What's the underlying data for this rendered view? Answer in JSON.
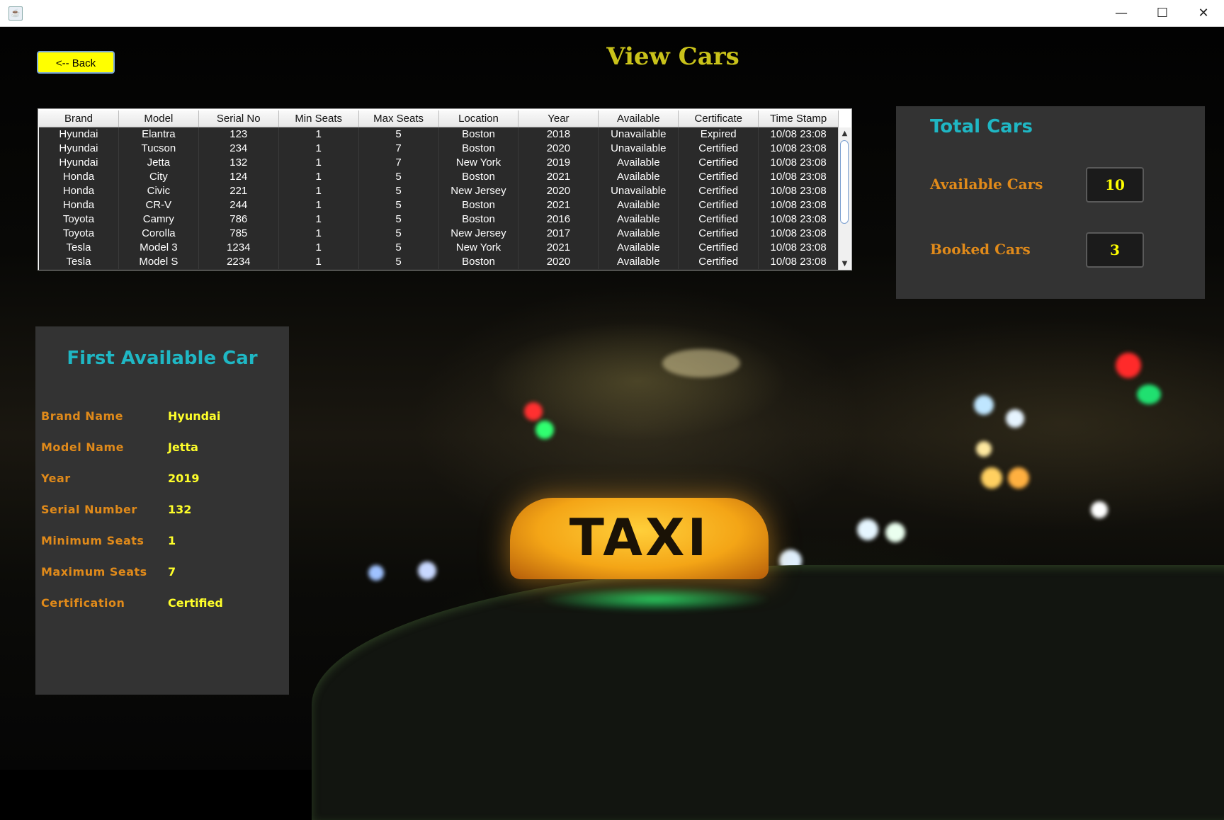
{
  "window": {
    "minimize_glyph": "—",
    "maximize_glyph": "☐",
    "close_glyph": "✕"
  },
  "back_button": "<-- Back",
  "page_title": "View Cars",
  "table": {
    "headers": [
      "Brand",
      "Model",
      "Serial No",
      "Min Seats",
      "Max Seats",
      "Location",
      "Year",
      "Available",
      "Certificate",
      "Time Stamp"
    ],
    "rows": [
      [
        "Hyundai",
        "Elantra",
        "123",
        "1",
        "5",
        "Boston",
        "2018",
        "Unavailable",
        "Expired",
        "10/08 23:08"
      ],
      [
        "Hyundai",
        "Tucson",
        "234",
        "1",
        "7",
        "Boston",
        "2020",
        "Unavailable",
        "Certified",
        "10/08 23:08"
      ],
      [
        "Hyundai",
        "Jetta",
        "132",
        "1",
        "7",
        "New York",
        "2019",
        "Available",
        "Certified",
        "10/08 23:08"
      ],
      [
        "Honda",
        "City",
        "124",
        "1",
        "5",
        "Boston",
        "2021",
        "Available",
        "Certified",
        "10/08 23:08"
      ],
      [
        "Honda",
        "Civic",
        "221",
        "1",
        "5",
        "New Jersey",
        "2020",
        "Unavailable",
        "Certified",
        "10/08 23:08"
      ],
      [
        "Honda",
        "CR-V",
        "244",
        "1",
        "5",
        "Boston",
        "2021",
        "Available",
        "Certified",
        "10/08 23:08"
      ],
      [
        "Toyota",
        "Camry",
        "786",
        "1",
        "5",
        "Boston",
        "2016",
        "Available",
        "Certified",
        "10/08 23:08"
      ],
      [
        "Toyota",
        "Corolla",
        "785",
        "1",
        "5",
        "New Jersey",
        "2017",
        "Available",
        "Certified",
        "10/08 23:08"
      ],
      [
        "Tesla",
        "Model 3",
        "1234",
        "1",
        "5",
        "New York",
        "2021",
        "Available",
        "Certified",
        "10/08 23:08"
      ],
      [
        "Tesla",
        "Model S",
        "2234",
        "1",
        "5",
        "Boston",
        "2020",
        "Available",
        "Certified",
        "10/08 23:08"
      ]
    ]
  },
  "totals": {
    "title": "Total Cars",
    "available_label": "Available Cars",
    "available_value": "10",
    "booked_label": "Booked Cars",
    "booked_value": "3"
  },
  "first_available": {
    "title": "First Available Car",
    "fields": [
      {
        "label": "Brand Name",
        "value": "Hyundai"
      },
      {
        "label": "Model Name",
        "value": "Jetta"
      },
      {
        "label": "Year",
        "value": "2019"
      },
      {
        "label": "Serial Number",
        "value": "132"
      },
      {
        "label": "Minimum Seats",
        "value": "1"
      },
      {
        "label": "Maximum Seats",
        "value": "7"
      },
      {
        "label": "Certification",
        "value": "Certified"
      }
    ]
  },
  "background": {
    "sign_text": "TAXI"
  }
}
